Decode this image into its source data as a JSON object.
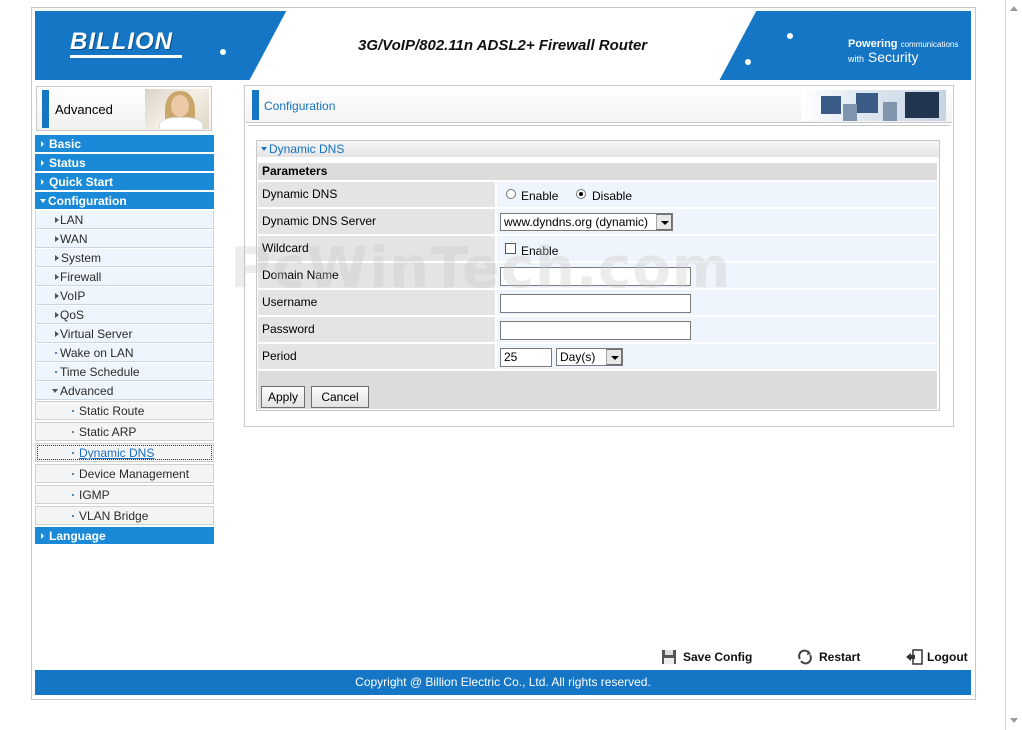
{
  "header": {
    "logo": "BILLION",
    "title": "3G/VoIP/802.11n ADSL2+ Firewall Router",
    "tagline_powering": "Powering",
    "tagline_comm": "communications",
    "tagline_with": "with",
    "tagline_security": "Security"
  },
  "sidebar": {
    "header_label": "Advanced",
    "items": [
      {
        "label": "Basic"
      },
      {
        "label": "Status"
      },
      {
        "label": "Quick Start"
      },
      {
        "label": "Configuration"
      },
      {
        "label": "LAN"
      },
      {
        "label": "WAN"
      },
      {
        "label": "System"
      },
      {
        "label": "Firewall"
      },
      {
        "label": "VoIP"
      },
      {
        "label": "QoS"
      },
      {
        "label": "Virtual Server"
      },
      {
        "label": "Wake on LAN"
      },
      {
        "label": "Time Schedule"
      },
      {
        "label": "Advanced"
      },
      {
        "label": "Static Route"
      },
      {
        "label": "Static ARP"
      },
      {
        "label": "Dynamic DNS"
      },
      {
        "label": "Device Management"
      },
      {
        "label": "IGMP"
      },
      {
        "label": "VLAN Bridge"
      },
      {
        "label": "Language"
      }
    ]
  },
  "main": {
    "page_title": "Configuration",
    "section_title": "Dynamic DNS",
    "params_title": "Parameters",
    "fields": {
      "ddns_label": "Dynamic DNS",
      "enable_label": "Enable",
      "disable_label": "Disable",
      "ddns_selected": "Disable",
      "server_label": "Dynamic DNS Server",
      "server_value": "www.dyndns.org (dynamic)",
      "wildcard_label": "Wildcard",
      "wildcard_enable_label": "Enable",
      "domain_label": "Domain Name",
      "domain_value": "",
      "username_label": "Username",
      "username_value": "",
      "password_label": "Password",
      "password_value": "",
      "period_label": "Period",
      "period_value": "25",
      "period_unit": "Day(s)"
    },
    "apply_label": "Apply",
    "cancel_label": "Cancel"
  },
  "watermark": "PcWinTech.com",
  "tools": {
    "save_label": "Save Config",
    "restart_label": "Restart",
    "logout_label": "Logout"
  },
  "footer": {
    "copyright": "Copyright @ Billion Electric Co., Ltd. All rights reserved."
  },
  "colors": {
    "brand_blue": "#1476c4",
    "menu_blue": "#1a8ad8",
    "link_blue": "#1573c0"
  }
}
